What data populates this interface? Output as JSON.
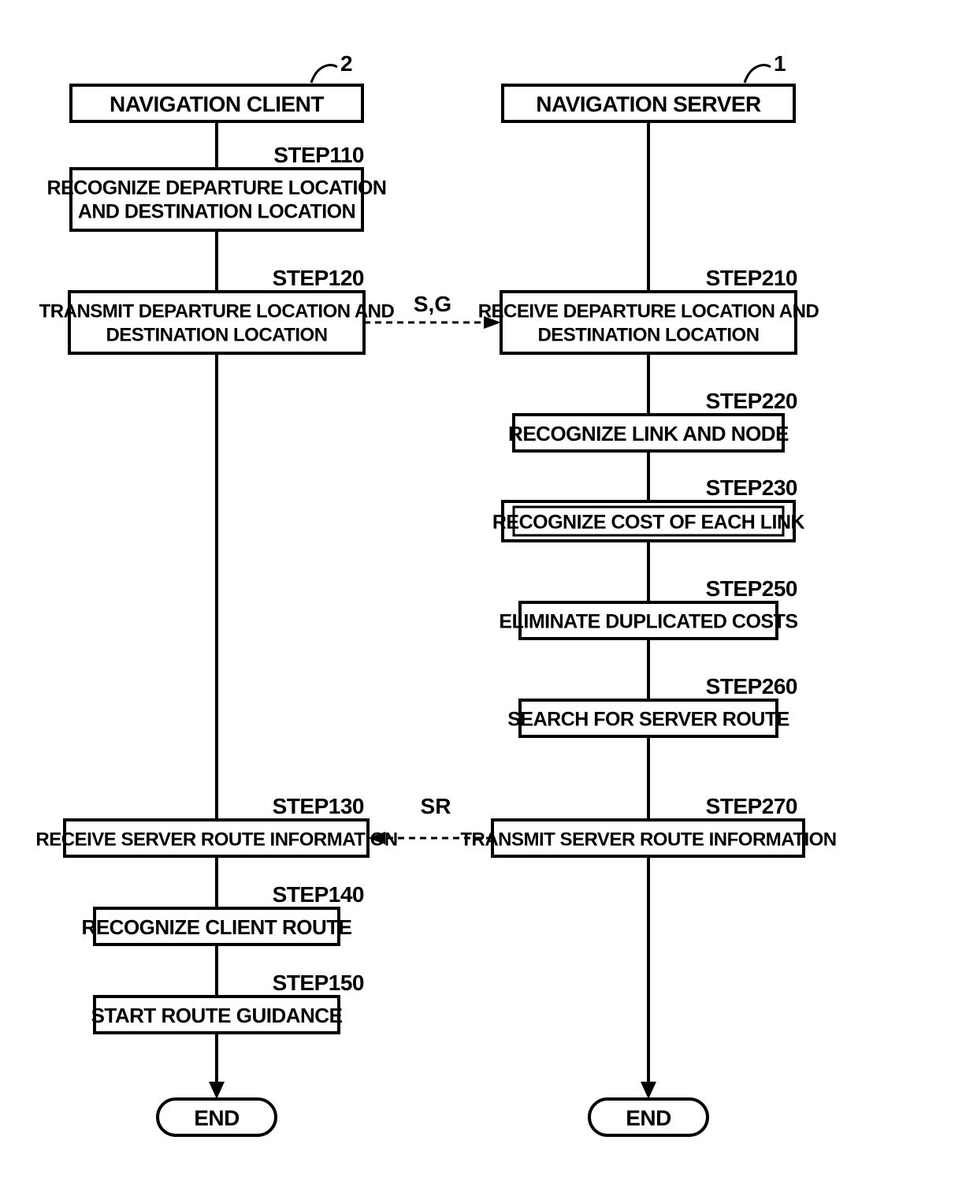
{
  "client": {
    "ref": "2",
    "title": "NAVIGATION CLIENT",
    "steps": [
      {
        "id": "STEP110",
        "text": [
          "RECOGNIZE DEPARTURE LOCATION",
          "AND DESTINATION LOCATION"
        ]
      },
      {
        "id": "STEP120",
        "text": [
          "TRANSMIT DEPARTURE LOCATION AND",
          "DESTINATION LOCATION"
        ]
      },
      {
        "id": "STEP130",
        "text": [
          "RECEIVE SERVER ROUTE INFORMATION"
        ]
      },
      {
        "id": "STEP140",
        "text": [
          "RECOGNIZE CLIENT ROUTE"
        ]
      },
      {
        "id": "STEP150",
        "text": [
          "START ROUTE GUIDANCE"
        ]
      }
    ],
    "end": "END"
  },
  "server": {
    "ref": "1",
    "title": "NAVIGATION SERVER",
    "steps": [
      {
        "id": "STEP210",
        "text": [
          "RECEIVE DEPARTURE LOCATION AND",
          "DESTINATION LOCATION"
        ]
      },
      {
        "id": "STEP220",
        "text": [
          "RECOGNIZE LINK AND NODE"
        ]
      },
      {
        "id": "STEP230",
        "text": [
          "RECOGNIZE COST OF EACH LINK"
        ],
        "nested": true
      },
      {
        "id": "STEP250",
        "text": [
          "ELIMINATE DUPLICATED COSTS"
        ]
      },
      {
        "id": "STEP260",
        "text": [
          "SEARCH FOR SERVER ROUTE"
        ]
      },
      {
        "id": "STEP270",
        "text": [
          "TRANSMIT SERVER ROUTE INFORMATION"
        ]
      }
    ],
    "end": "END"
  },
  "messages": {
    "sg": "S,G",
    "sr": "SR"
  }
}
